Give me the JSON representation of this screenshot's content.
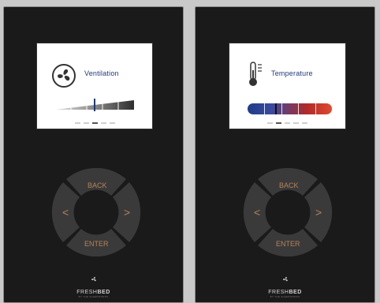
{
  "panels": [
    {
      "screen": {
        "title": "Ventilation",
        "icon": "fan-icon",
        "ramp_level": 0.5,
        "page_dots": 5,
        "active_dot": 2
      },
      "buttons": {
        "back": "BACK",
        "enter": "ENTER",
        "left": "<",
        "right": ">"
      },
      "brand": {
        "name_light": "FRESH",
        "name_bold": "BED",
        "tagline": "BY THE SLEEPWORKS"
      }
    },
    {
      "screen": {
        "title": "Temperature",
        "icon": "thermometer-icon",
        "temp_level": 0.33,
        "page_dots": 5,
        "active_dot": 1
      },
      "buttons": {
        "back": "BACK",
        "enter": "ENTER",
        "left": "<",
        "right": ">"
      },
      "brand": {
        "name_light": "FRESH",
        "name_bold": "BED",
        "tagline": "BY THE SLEEPWORKS"
      }
    }
  ],
  "colors": {
    "label": "#1e3a78",
    "button_text": "#b5835a",
    "button_fill": "#3a3a3a",
    "panel": "#1a1a1a"
  }
}
